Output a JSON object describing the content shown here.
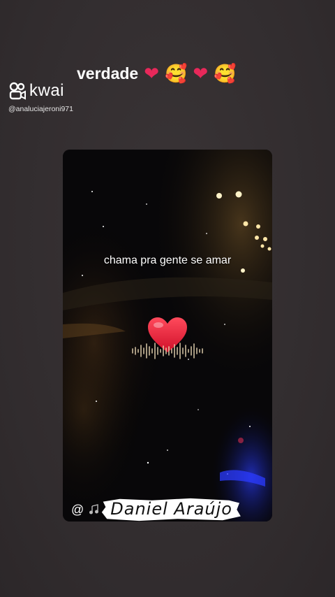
{
  "header": {
    "brand_name": "kwai",
    "handle": "@analuciajeroni971",
    "logo_icon": "kwai-logo-icon"
  },
  "caption": {
    "text": "verdade",
    "emojis": [
      "❤",
      "🥰",
      "❤",
      "🥰"
    ]
  },
  "video": {
    "overlay_text": "chama pra gente se amar",
    "credit_prefix": "@",
    "artist": "Daniel Araújo",
    "heart_icon": "heart-icon",
    "waveform_icon": "audio-waveform-icon"
  },
  "colors": {
    "background": "#342f31",
    "heart": "#e8285a",
    "waveform": "#e9d7b4"
  }
}
